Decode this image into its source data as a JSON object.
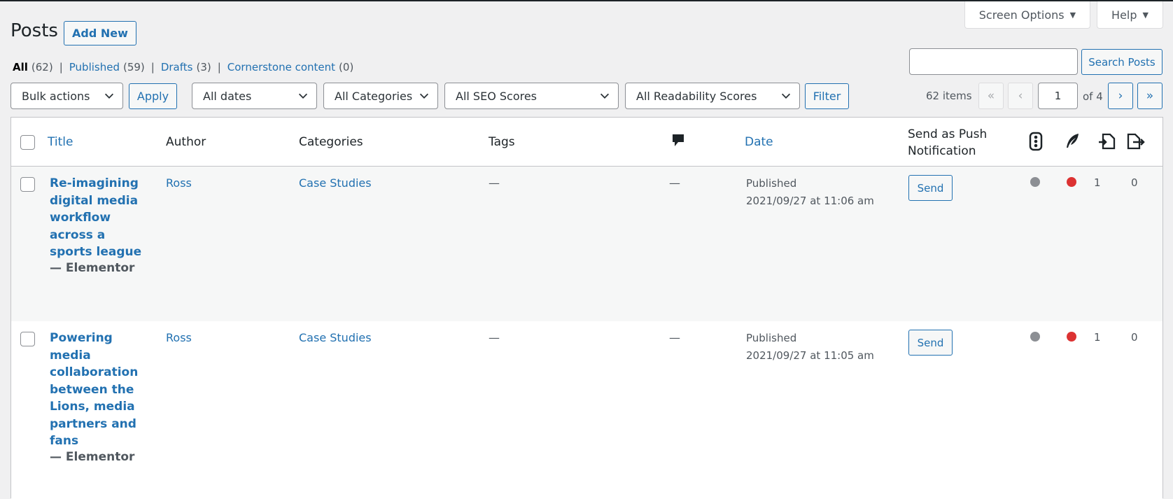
{
  "header": {
    "title": "Posts",
    "add_new": "Add New",
    "screen_options": "Screen Options",
    "help": "Help"
  },
  "views": [
    {
      "label": "All",
      "count": "(62)"
    },
    {
      "label": "Published",
      "count": "(59)"
    },
    {
      "label": "Drafts",
      "count": "(3)"
    },
    {
      "label": "Cornerstone content",
      "count": "(0)"
    }
  ],
  "search": {
    "value": "",
    "button": "Search Posts"
  },
  "filters": {
    "bulk_actions": "Bulk actions",
    "apply": "Apply",
    "dates": "All dates",
    "categories": "All Categories",
    "seo": "All SEO Scores",
    "readability": "All Readability Scores",
    "filter": "Filter"
  },
  "pagination": {
    "items": "62 items",
    "first": "«",
    "prev": "‹",
    "current_page": "1",
    "of": "of 4",
    "next": "›",
    "last": "»"
  },
  "columns": {
    "title": "Title",
    "author": "Author",
    "categories": "Categories",
    "tags": "Tags",
    "date": "Date",
    "push_line1": "Send as Push",
    "push_line2": "Notification"
  },
  "icons": {
    "comments": "comment-bubble-icon",
    "seo": "traffic-light-icon",
    "readability": "feather-icon",
    "inlinks": "incoming-links-icon",
    "outlinks": "outgoing-links-icon"
  },
  "colors": {
    "link": "#2271b1",
    "seo_dot": "#8c8f94",
    "readability_dot": "#dc3232"
  },
  "rows": [
    {
      "title": "Re-imagining digital media workflow across a sports league",
      "state": "— Elementor",
      "author": "Ross",
      "category": "Case Studies",
      "tags": "—",
      "comments": "—",
      "status": "Published",
      "date": "2021/09/27 at 11:06 am",
      "send": "Send",
      "links_in": "1",
      "links_out": "0"
    },
    {
      "title": "Powering media collaboration between the Lions, media partners and fans",
      "state": "— Elementor",
      "author": "Ross",
      "category": "Case Studies",
      "tags": "—",
      "comments": "—",
      "status": "Published",
      "date": "2021/09/27 at 11:05 am",
      "send": "Send",
      "links_in": "1",
      "links_out": "0"
    }
  ]
}
